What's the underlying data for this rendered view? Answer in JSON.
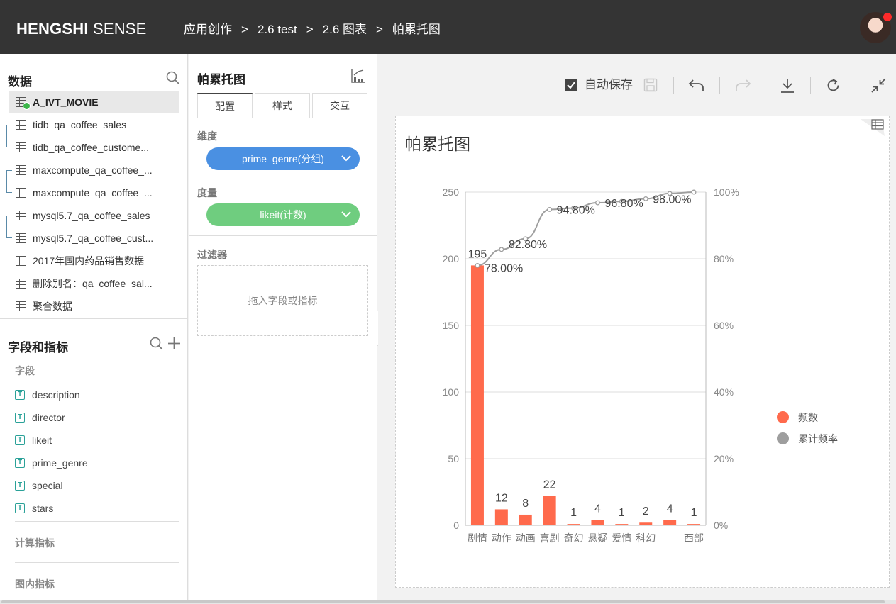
{
  "app": {
    "logo_bold": "HENGSHI",
    "logo_rest": " SENSE",
    "breadcrumbs": [
      "应用创作",
      "2.6 test",
      "2.6 图表",
      "帕累托图"
    ],
    "breadcrumb_sep": ">"
  },
  "data_panel": {
    "title": "数据",
    "datasets": [
      {
        "label": "A_IVT_MOVIE",
        "active": true
      },
      {
        "label": "tidb_qa_coffee_sales"
      },
      {
        "label": "tidb_qa_coffee_custome..."
      },
      {
        "label": "maxcompute_qa_coffee_..."
      },
      {
        "label": "maxcompute_qa_coffee_..."
      },
      {
        "label": "mysql5.7_qa_coffee_sales"
      },
      {
        "label": "mysql5.7_qa_coffee_cust..."
      },
      {
        "label": "2017年国内药品销售数据"
      },
      {
        "label": "删除别名：qa_coffee_sal..."
      },
      {
        "label": "聚合数据"
      }
    ]
  },
  "fields_panel": {
    "title": "字段和指标",
    "fields_label": "字段",
    "fields": [
      "description",
      "director",
      "likeit",
      "prime_genre",
      "special",
      "stars"
    ],
    "calc_label": "计算指标",
    "inner_label": "图内指标"
  },
  "config": {
    "title": "帕累托图",
    "tabs": [
      "配置",
      "样式",
      "交互"
    ],
    "dimension_label": "维度",
    "dimension_value": "prime_genre(分组)",
    "measure_label": "度量",
    "measure_value": "likeit(计数)",
    "filter_label": "过滤器",
    "filter_placeholder": "拖入字段或指标"
  },
  "toolbar": {
    "autosave_label": "自动保存"
  },
  "colors": {
    "bar": "#ff6a4c",
    "line": "#9e9e9e",
    "dimension_pill": "#4a90e2",
    "measure_pill": "#6fcd7f"
  },
  "chart_data": {
    "type": "bar",
    "title": "帕累托图",
    "categories": [
      "剧情",
      "动作",
      "动画",
      "喜剧",
      "奇幻",
      "悬疑",
      "爱情",
      "科幻",
      "",
      "西部"
    ],
    "series": [
      {
        "name": "频数",
        "type": "bar",
        "values": [
          195,
          12,
          8,
          22,
          1,
          4,
          1,
          2,
          4,
          1
        ]
      },
      {
        "name": "累计频率",
        "type": "line",
        "values": [
          78.0,
          82.8,
          86.0,
          94.8,
          95.2,
          96.8,
          97.2,
          98.0,
          99.6,
          100.0
        ]
      }
    ],
    "bar_labels": [
      "195",
      "12",
      "8",
      "22",
      "1",
      "4",
      "1",
      "2",
      "4",
      "1"
    ],
    "line_labels": [
      {
        "index": 0,
        "text": "78.00%"
      },
      {
        "index": 1,
        "text": "82.80%"
      },
      {
        "index": 3,
        "text": "94.80%"
      },
      {
        "index": 5,
        "text": "96.80%"
      },
      {
        "index": 7,
        "text": "98.00%"
      }
    ],
    "ylim": [
      0,
      250
    ],
    "yticks": [
      "0",
      "50",
      "100",
      "150",
      "200",
      "250"
    ],
    "y2lim": [
      0,
      100
    ],
    "y2ticks": [
      "0%",
      "20%",
      "40%",
      "60%",
      "80%",
      "100%"
    ],
    "legend": [
      "频数",
      "累计频率"
    ],
    "legend_position": "right",
    "grid": true
  }
}
